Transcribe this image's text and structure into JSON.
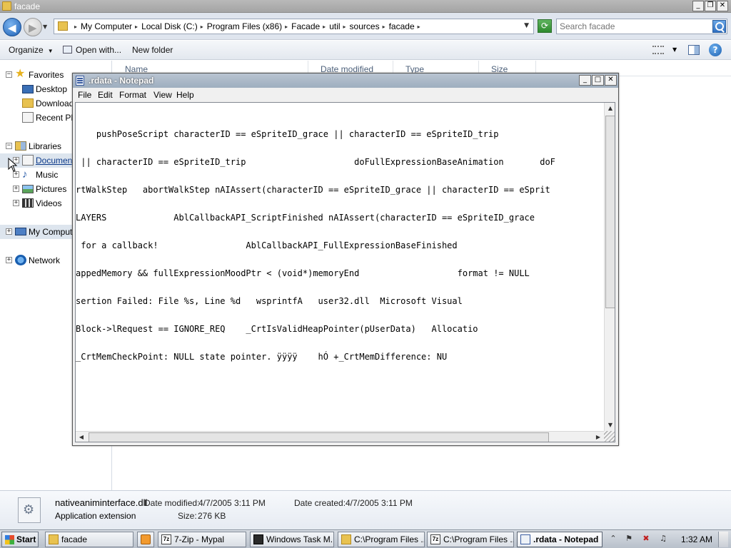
{
  "explorer": {
    "title": "facade",
    "breadcrumbs": [
      "My Computer",
      "Local Disk (C:)",
      "Program Files (x86)",
      "Facade",
      "util",
      "sources",
      "facade"
    ],
    "search_placeholder": "Search facade",
    "toolbar": {
      "organize": "Organize",
      "open_with": "Open with...",
      "new_folder": "New folder"
    },
    "columns": [
      "Name",
      "Date modified",
      "Type",
      "Size"
    ],
    "nav": {
      "favorites": "Favorites",
      "desktop": "Desktop",
      "downloads": "Downloads",
      "recent_places": "Recent Places",
      "libraries": "Libraries",
      "documents": "Documents",
      "music": "Music",
      "pictures": "Pictures",
      "videos": "Videos",
      "my_computer": "My Computer",
      "network": "Network"
    },
    "details": {
      "filename": "nativeaniminterface.dll",
      "file_type": "Application extension",
      "date_modified_label": "Date modified:",
      "date_modified": "4/7/2005 3:11 PM",
      "date_created_label": "Date created:",
      "date_created": "4/7/2005 3:11 PM",
      "size_label": "Size:",
      "size": "276 KB"
    }
  },
  "notepad": {
    "title": ".rdata - Notepad",
    "menu": [
      "File",
      "Edit",
      "Format",
      "View",
      "Help"
    ],
    "lines": [
      "    pushPoseScript characterID == eSpriteID_grace || characterID == eSpriteID_trip",
      " || characterID == eSpriteID_trip                     doFullExpressionBaseAnimation       doF",
      "rtWalkStep   abortWalkStep nAIAssert(characterID == eSpriteID_grace || characterID == eSprit",
      "LAYERS             AblCallbackAPI_ScriptFinished nAIAssert(characterID == eSpriteID_grace",
      " for a callback!                 AblCallbackAPI_FullExpressionBaseFinished",
      "appedMemory && fullExpressionMoodPtr < (void*)memoryEnd                   format != NULL",
      "sertion Failed: File %s, Line %d   wsprintfA   user32.dll  Microsoft Visual",
      "Block->lRequest == IGNORE_REQ    _CrtIsValidHeapPointer(pUserData)   Allocatio",
      "_CrtMemCheckPoint: NULL state pointer. ÿÿÿÿ    hÓ +_CrtMemDifference: NU"
    ]
  },
  "taskbar": {
    "start": "Start",
    "tasks": [
      {
        "label": "facade",
        "icon": "folder-icon"
      },
      {
        "label": "",
        "icon": "media-player-icon"
      },
      {
        "label": "7-Zip - Mypal",
        "icon": "7zip-icon"
      },
      {
        "label": "Windows Task M...",
        "icon": "task-manager-icon"
      },
      {
        "label": "C:\\Program Files ...",
        "icon": "folder-icon"
      },
      {
        "label": "C:\\Program Files ...",
        "icon": "7zip-icon"
      },
      {
        "label": ".rdata - Notepad",
        "icon": "notepad-icon"
      }
    ],
    "clock": "1:32 AM"
  }
}
